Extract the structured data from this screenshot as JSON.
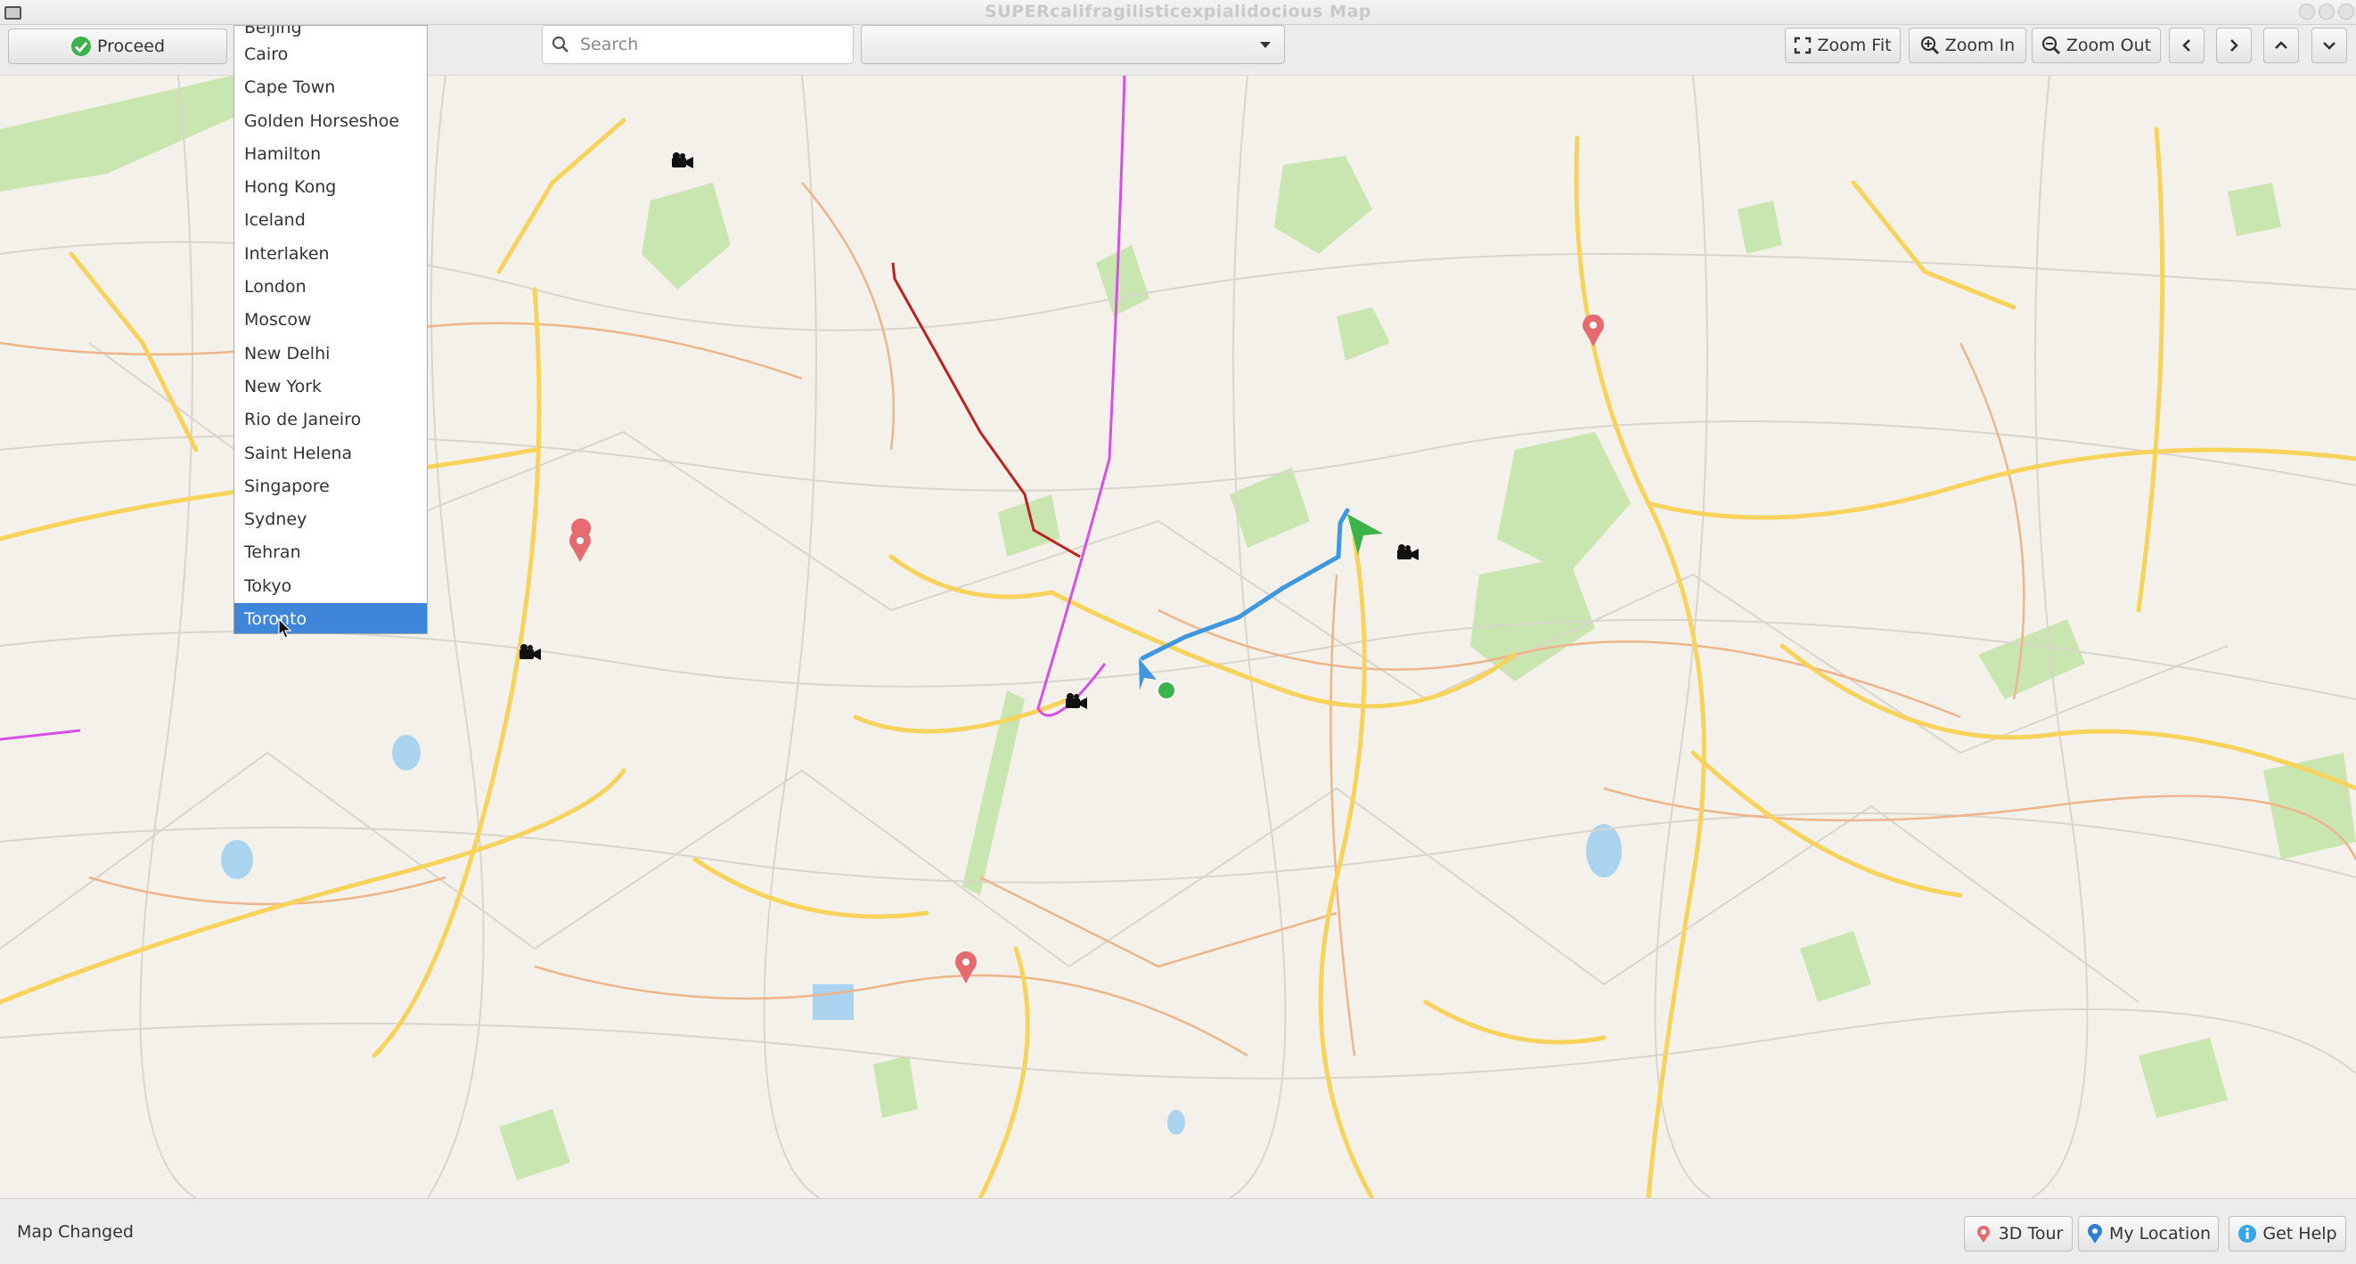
{
  "window": {
    "title": "SUPERcalifragilisticexpialidocious Map"
  },
  "toolbar": {
    "proceed_label": "Proceed",
    "search_placeholder": "Search",
    "search_value": "",
    "combo_value": "",
    "zoom_fit_label": "Zoom Fit",
    "zoom_in_label": "Zoom In",
    "zoom_out_label": "Zoom Out"
  },
  "city_list": {
    "partial_top_item": "Beijing",
    "items": [
      "Cairo",
      "Cape Town",
      "Golden Horseshoe",
      "Hamilton",
      "Hong Kong",
      "Iceland",
      "Interlaken",
      "London",
      "Moscow",
      "New Delhi",
      "New York",
      "Rio de Janeiro",
      "Saint Helena",
      "Singapore",
      "Sydney",
      "Tehran",
      "Tokyo",
      "Toronto"
    ],
    "selected": "Toronto"
  },
  "status": {
    "message": "Map Changed",
    "tour_label": "3D Tour",
    "location_label": "My Location",
    "help_label": "Get Help"
  },
  "colors": {
    "accent_selected": "#3d86d8",
    "route_blue": "#3f97e0",
    "route_red": "#c0201e",
    "route_magenta": "#d84fe6",
    "road_yellow": "#f7d35c",
    "road_orange": "#eeb48a",
    "park_green": "#c9e6b0",
    "water_blue": "#aad3ef",
    "pin_red": "#e66b70"
  }
}
